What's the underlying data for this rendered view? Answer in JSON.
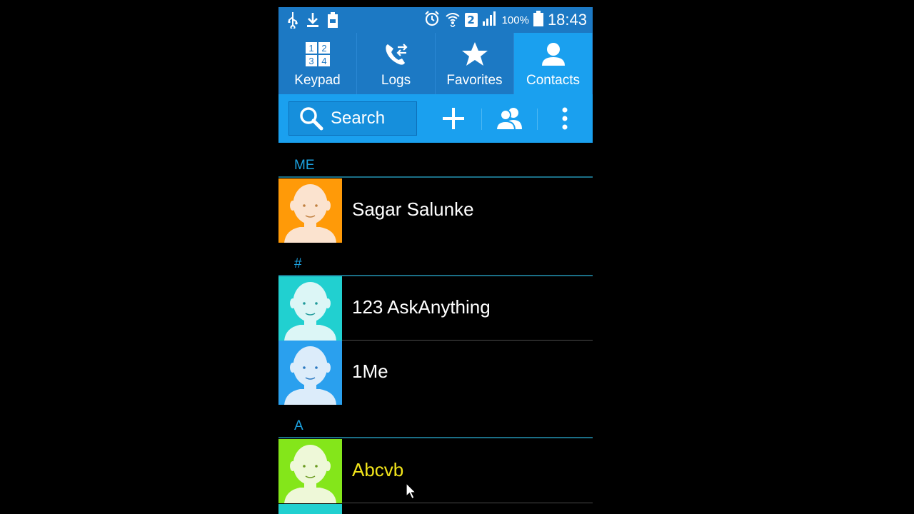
{
  "status_bar": {
    "battery_percent": "100%",
    "sim_slot": "2",
    "time": "18:43",
    "left_icons": [
      "usb-icon",
      "download-icon",
      "battery-saver-icon"
    ],
    "right_icons": [
      "alarm-icon",
      "wifi-icon",
      "sim-icon",
      "signal-icon",
      "battery-icon"
    ]
  },
  "tabs": [
    {
      "label": "Keypad",
      "icon": "keypad-icon"
    },
    {
      "label": "Logs",
      "icon": "logs-icon"
    },
    {
      "label": "Favorites",
      "icon": "star-icon"
    },
    {
      "label": "Contacts",
      "icon": "contact-icon",
      "active": true
    }
  ],
  "keypad_digits": [
    "1",
    "2",
    "3",
    "4"
  ],
  "action_bar": {
    "search_placeholder": "Search",
    "buttons": [
      "add-icon",
      "groups-icon",
      "more-icon"
    ]
  },
  "sections": [
    {
      "title": "ME",
      "contacts": [
        {
          "name": "Sagar Salunke",
          "avatar_color": "#ff9a08"
        }
      ]
    },
    {
      "title": "#",
      "contacts": [
        {
          "name": "123 AskAnything",
          "avatar_color": "#21d0d0"
        },
        {
          "name": "1Me",
          "avatar_color": "#2aa0ee"
        }
      ]
    },
    {
      "title": "A",
      "contacts": [
        {
          "name": "Abcvb",
          "avatar_color": "#84e61a",
          "highlighted": true
        }
      ]
    }
  ],
  "colors": {
    "status_bar": "#1c79c4",
    "active_tab": "#1aa0ef",
    "section_title": "#1ca2e0",
    "highlight_name": "#f2e51b"
  }
}
